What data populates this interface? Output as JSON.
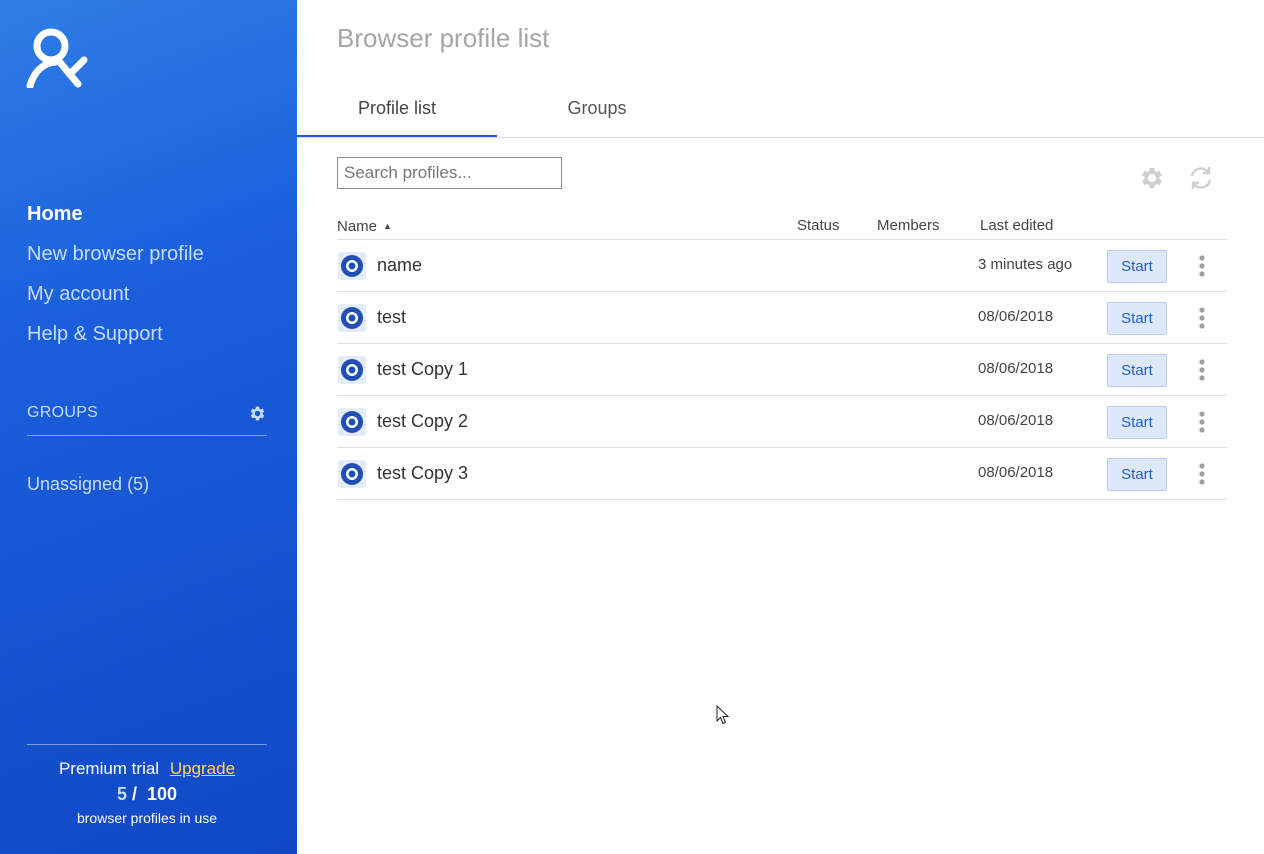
{
  "sidebar": {
    "nav": [
      {
        "label": "Home",
        "active": true
      },
      {
        "label": "New browser profile",
        "active": false
      },
      {
        "label": "My account",
        "active": false
      },
      {
        "label": "Help & Support",
        "active": false
      }
    ],
    "groups_title": "GROUPS",
    "groups": [
      {
        "label": "Unassigned (5)"
      }
    ],
    "plan": {
      "name": "Premium trial",
      "upgrade_label": "Upgrade",
      "used": "5",
      "separator": "/",
      "total": "100",
      "caption": "browser profiles in use"
    }
  },
  "main": {
    "title": "Browser profile list",
    "tabs": [
      {
        "label": "Profile list",
        "active": true
      },
      {
        "label": "Groups",
        "active": false
      }
    ],
    "search": {
      "placeholder": "Search profiles...",
      "value": ""
    },
    "table": {
      "columns": {
        "name": "Name",
        "status": "Status",
        "members": "Members",
        "last_edited": "Last edited"
      },
      "sort": {
        "column": "Name",
        "direction": "ascending"
      },
      "start_label": "Start",
      "rows": [
        {
          "name": "name",
          "status": "",
          "members": "",
          "last_edited": "3 minutes ago"
        },
        {
          "name": "test",
          "status": "",
          "members": "",
          "last_edited": "08/06/2018"
        },
        {
          "name": "test Copy 1",
          "status": "",
          "members": "",
          "last_edited": "08/06/2018"
        },
        {
          "name": "test Copy 2",
          "status": "",
          "members": "",
          "last_edited": "08/06/2018"
        },
        {
          "name": "test Copy 3",
          "status": "",
          "members": "",
          "last_edited": "08/06/2018"
        }
      ]
    }
  },
  "icons": {
    "logo": "multilogin-logo-icon",
    "groups_settings": "gear-icon",
    "toolbar_settings": "gear-icon",
    "toolbar_refresh": "refresh-icon",
    "profile_browser": "browser-profile-icon",
    "row_menu": "more-vertical-icon",
    "sort": "sort-ascending-icon"
  },
  "colors": {
    "sidebar_top": "#2f7ee6",
    "sidebar_bottom": "#1048c4",
    "accent": "#1f5fd0",
    "start_button_bg": "#dde8fb",
    "upgrade_link": "#ffd666"
  }
}
